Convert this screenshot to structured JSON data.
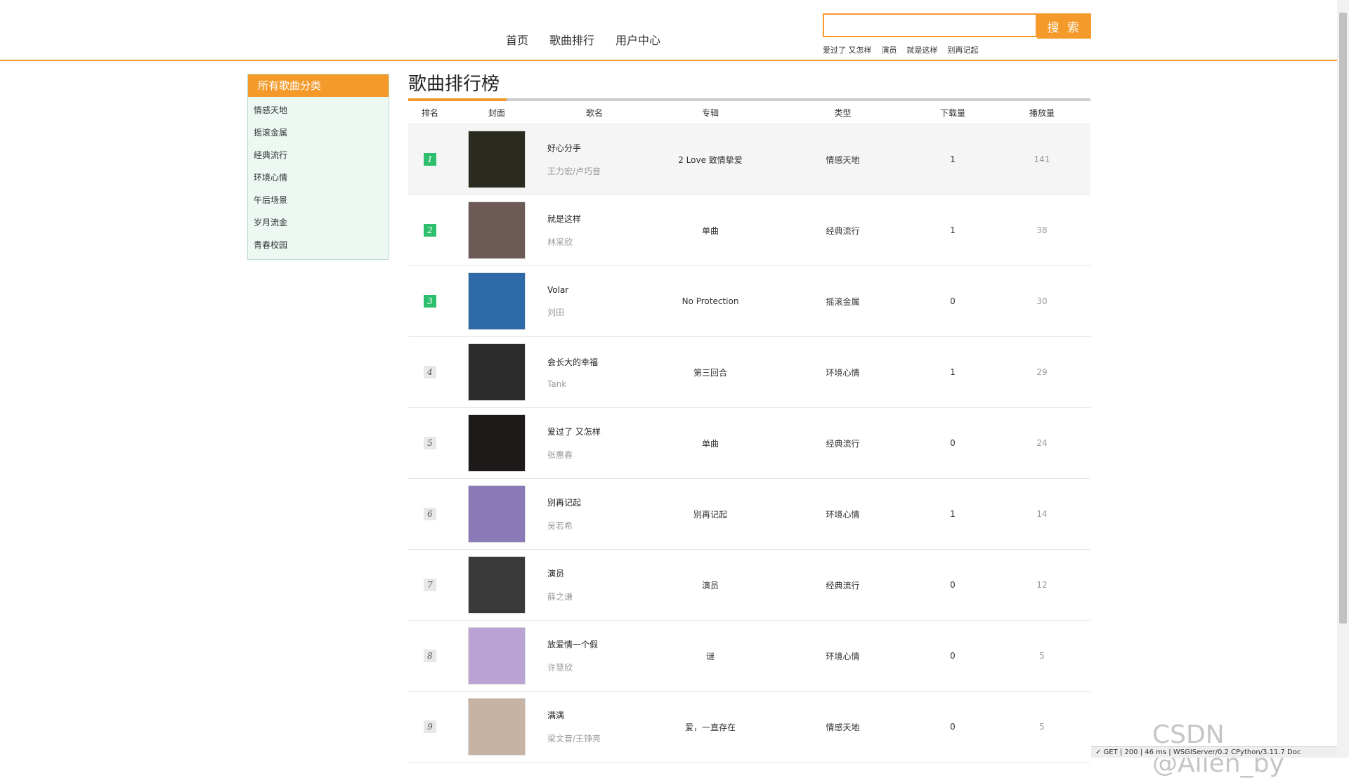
{
  "nav": {
    "items": [
      "首页",
      "歌曲排行",
      "用户中心"
    ]
  },
  "search": {
    "button_label": "搜 索",
    "placeholder": "",
    "hot_words": [
      "爱过了 又怎样",
      "演员",
      "就是这样",
      "别再记起"
    ]
  },
  "sidebar": {
    "title": "所有歌曲分类",
    "items": [
      "情感天地",
      "摇滚金属",
      "经典流行",
      "环境心情",
      "午后场景",
      "岁月流金",
      "青春校园"
    ]
  },
  "main": {
    "title": "歌曲排行榜",
    "columns": [
      "排名",
      "封面",
      "歌名",
      "专辑",
      "类型",
      "下载量",
      "播放量"
    ],
    "rows": [
      {
        "rank": "1",
        "name": "好心分手",
        "artist": "王力宏/卢巧音",
        "album": "2 Love 致情挚爱",
        "type": "情感天地",
        "downloads": "1",
        "plays": "141",
        "cover_color": "#2a2a1e"
      },
      {
        "rank": "2",
        "name": "就是这样",
        "artist": "林采欣",
        "album": "单曲",
        "type": "经典流行",
        "downloads": "1",
        "plays": "38",
        "cover_color": "#6b5a55"
      },
      {
        "rank": "3",
        "name": "Volar",
        "artist": "刘田",
        "album": "No Protection",
        "type": "摇滚金属",
        "downloads": "0",
        "plays": "30",
        "cover_color": "#2f6aa8"
      },
      {
        "rank": "4",
        "name": "会长大的幸福",
        "artist": "Tank",
        "album": "第三回合",
        "type": "环境心情",
        "downloads": "1",
        "plays": "29",
        "cover_color": "#2c2c2c"
      },
      {
        "rank": "5",
        "name": "爱过了 又怎样",
        "artist": "张惠春",
        "album": "单曲",
        "type": "经典流行",
        "downloads": "0",
        "plays": "24",
        "cover_color": "#1e1a1a"
      },
      {
        "rank": "6",
        "name": "别再记起",
        "artist": "吴若希",
        "album": "别再记起",
        "type": "环境心情",
        "downloads": "1",
        "plays": "14",
        "cover_color": "#8a7ab8"
      },
      {
        "rank": "7",
        "name": "演员",
        "artist": "薛之谦",
        "album": "演员",
        "type": "经典流行",
        "downloads": "0",
        "plays": "12",
        "cover_color": "#3a3a3a"
      },
      {
        "rank": "8",
        "name": "放爱情一个假",
        "artist": "许慧欣",
        "album": "谜",
        "type": "环境心情",
        "downloads": "0",
        "plays": "5",
        "cover_color": "#b9a4d4"
      },
      {
        "rank": "9",
        "name": "满满",
        "artist": "梁文音/王铮亮",
        "album": "爱，一直存在",
        "type": "情感天地",
        "downloads": "0",
        "plays": "5",
        "cover_color": "#c7b3a4"
      }
    ]
  },
  "watermark": "CSDN @Allen_by",
  "debug_bar": "✓ GET | 200 | 46 ms | WSGIServer/0.2 CPython/3.11.7  Doc"
}
